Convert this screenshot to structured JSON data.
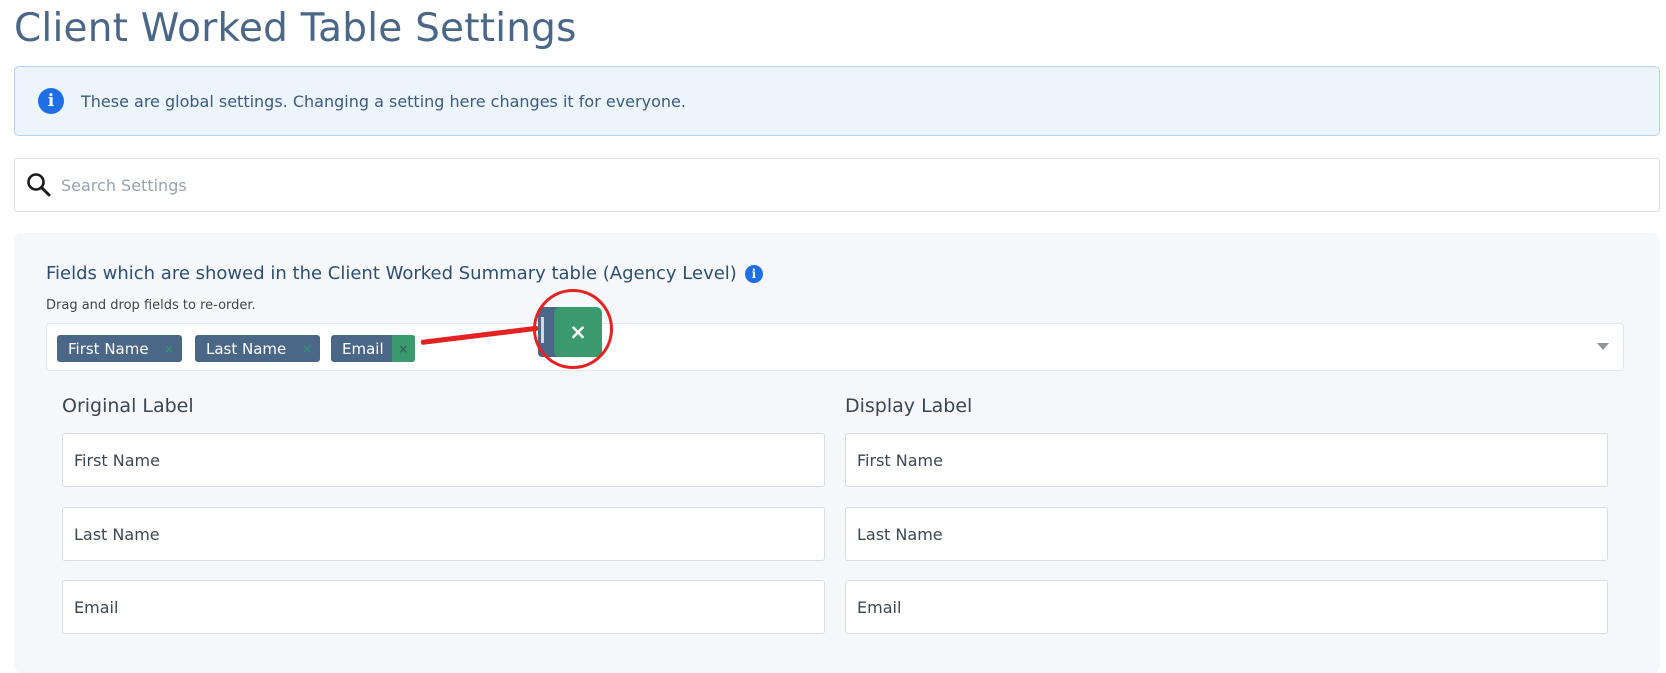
{
  "page": {
    "title": "Client Worked Table Settings"
  },
  "banner": {
    "text": "These are global settings. Changing a setting here changes it for everyone.",
    "icon": "info-icon"
  },
  "search": {
    "placeholder": "Search Settings",
    "value": "",
    "icon": "search-icon"
  },
  "section": {
    "title": "Fields which are showed in the Client Worked Summary table (Agency Level)",
    "hint": "Drag and drop fields to re-order.",
    "tags": [
      {
        "label": "First Name",
        "remove": "×"
      },
      {
        "label": "Last Name",
        "remove": "×"
      },
      {
        "label": "Email",
        "remove": "×"
      }
    ],
    "zoom_remove": "×"
  },
  "columns": {
    "original": "Original Label",
    "display": "Display Label"
  },
  "rows": [
    {
      "original": "First Name",
      "display": "First Name"
    },
    {
      "original": "Last Name",
      "display": "Last Name"
    },
    {
      "original": "Email",
      "display": "Email"
    }
  ],
  "colors": {
    "title": "#4a6787",
    "tag_bg": "#4a6787",
    "remove_green": "#3a9a6e",
    "annotation_red": "#e52222",
    "banner_bg": "#ecf4fe",
    "info_blue": "#1e6fe6"
  }
}
